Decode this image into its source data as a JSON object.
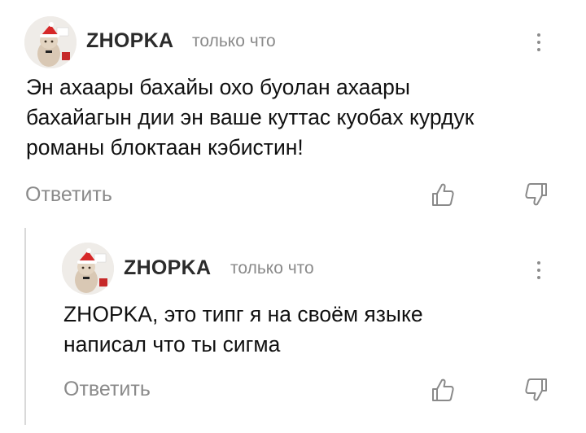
{
  "comments": [
    {
      "author": "ZHOPKA",
      "time": "только что",
      "text": "Эн ахаары бахайы охо буолан ахаары\nбахайагын дии эн ваше куттас куобах курдук\nроманы блоктаан кэбистин!",
      "reply_label": "Ответить",
      "avatar_icon": "cat-with-santa-hat-avatar"
    },
    {
      "author": "ZHOPKA",
      "time": "только что",
      "text": "ZHOPKA, это типг я на своём языке\nнаписал что ты сигма",
      "reply_label": "Ответить",
      "avatar_icon": "cat-with-santa-hat-avatar"
    }
  ],
  "colors": {
    "author": "#2b2b2b",
    "muted": "#8a8a8a",
    "thread_line": "#d9d9d9"
  }
}
